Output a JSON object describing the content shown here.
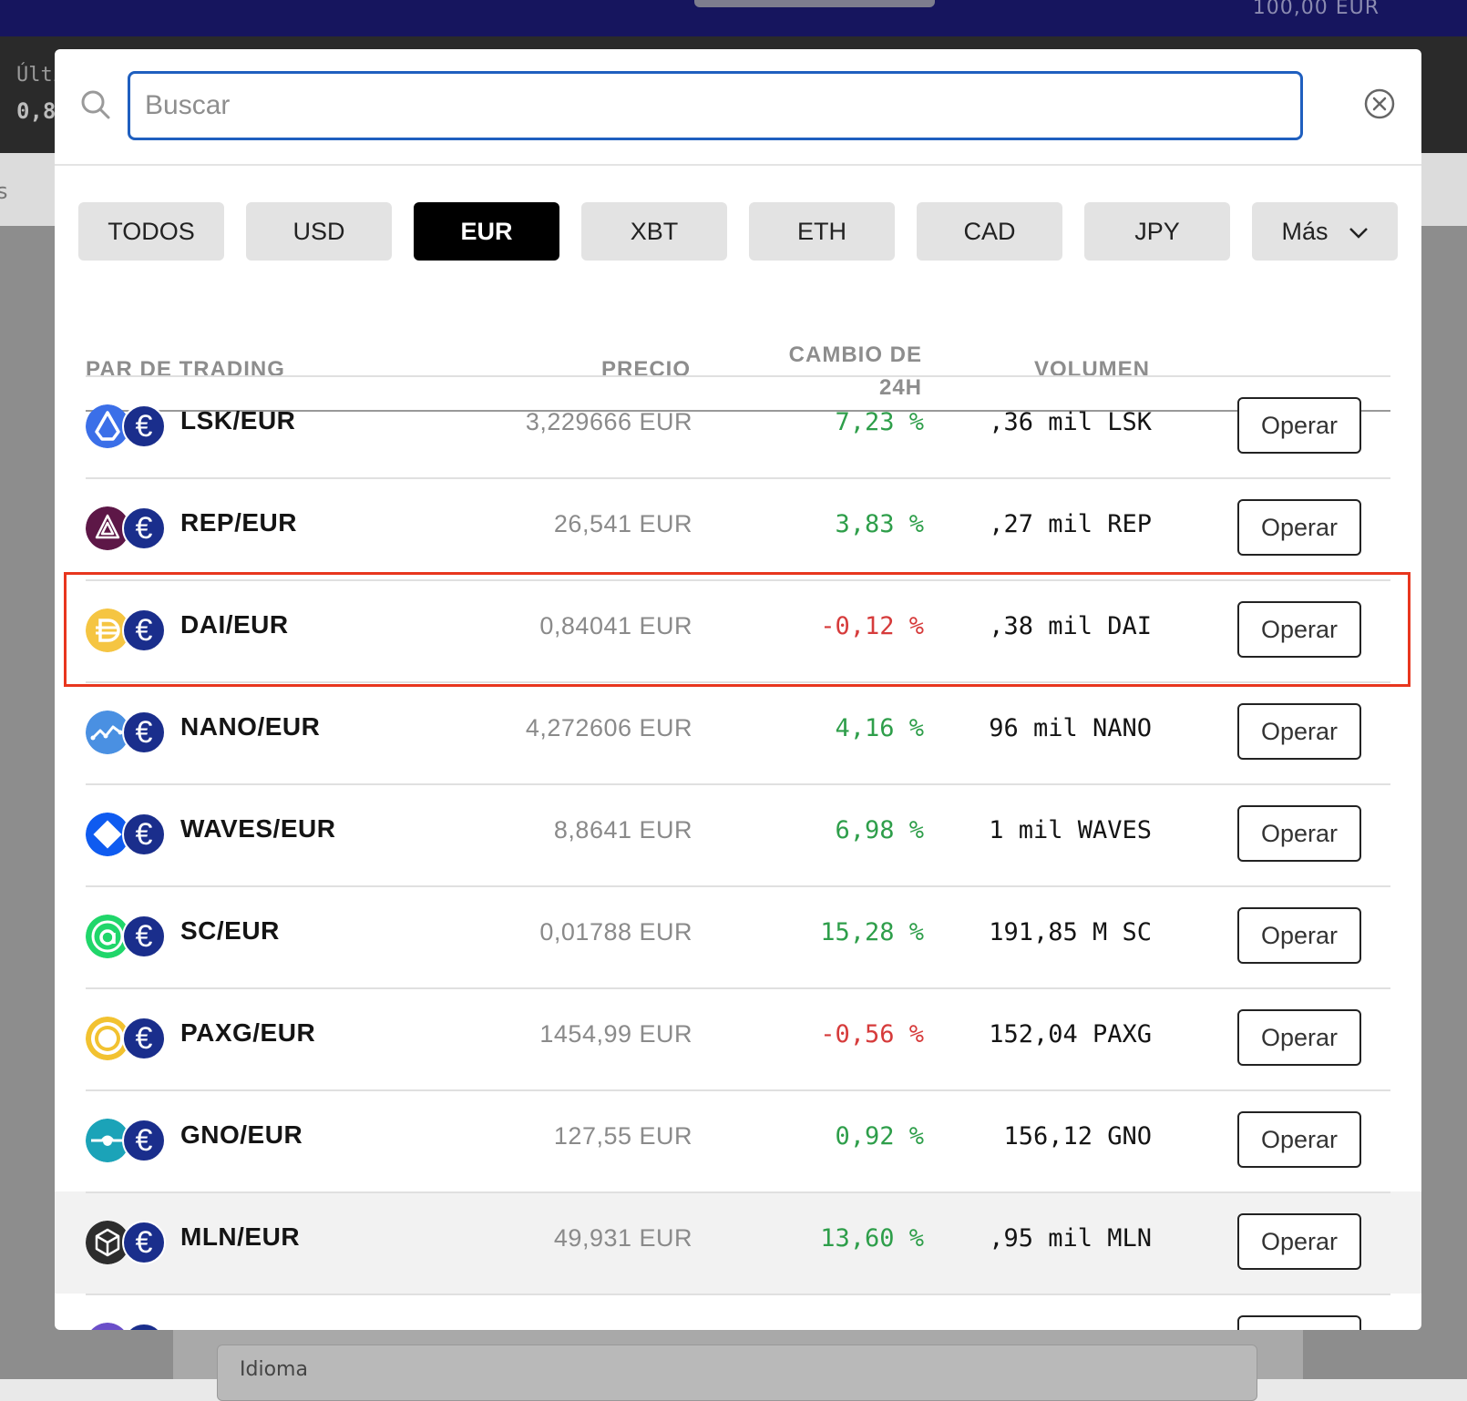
{
  "background": {
    "topbar_amount": "100,00 EUR",
    "last_label": "Últi",
    "last_value": "0,8",
    "side_label": "s",
    "language_label": "Idioma"
  },
  "search": {
    "placeholder": "Buscar",
    "value": ""
  },
  "tabs": [
    {
      "label": "TODOS",
      "active": false
    },
    {
      "label": "USD",
      "active": false
    },
    {
      "label": "EUR",
      "active": true
    },
    {
      "label": "XBT",
      "active": false
    },
    {
      "label": "ETH",
      "active": false
    },
    {
      "label": "CAD",
      "active": false
    },
    {
      "label": "JPY",
      "active": false
    },
    {
      "label": "Más",
      "active": false
    }
  ],
  "table": {
    "headers": {
      "pair": "PAR DE TRADING",
      "price": "PRECIO",
      "change_line1": "CAMBIO DE",
      "change_line2": "24H",
      "volume": "VOLUMEN"
    },
    "rows": [
      {
        "pair": "LSK/EUR",
        "price": "3,229666 EUR",
        "change": "7,23 %",
        "direction": "pos",
        "volume": ",36 mil LSK",
        "action": "Operar",
        "icon": "lisk-icon",
        "icon_color": "#3b6fe8"
      },
      {
        "pair": "REP/EUR",
        "price": "26,541 EUR",
        "change": "3,83 %",
        "direction": "pos",
        "volume": ",27 mil REP",
        "action": "Operar",
        "icon": "augur-icon",
        "icon_color": "#5d1747"
      },
      {
        "pair": "DAI/EUR",
        "price": "0,84041 EUR",
        "change": "-0,12 %",
        "direction": "neg",
        "volume": ",38 mil DAI",
        "action": "Operar",
        "icon": "dai-icon",
        "icon_color": "#f5c542"
      },
      {
        "pair": "NANO/EUR",
        "price": "4,272606 EUR",
        "change": "4,16 %",
        "direction": "pos",
        "volume": "96 mil NANO",
        "action": "Operar",
        "icon": "nano-icon",
        "icon_color": "#4a90e2"
      },
      {
        "pair": "WAVES/EUR",
        "price": "8,8641 EUR",
        "change": "6,98 %",
        "direction": "pos",
        "volume": "1 mil WAVES",
        "action": "Operar",
        "icon": "waves-icon",
        "icon_color": "#0f5bf0"
      },
      {
        "pair": "SC/EUR",
        "price": "0,01788 EUR",
        "change": "15,28 %",
        "direction": "pos",
        "volume": "191,85 M SC",
        "action": "Operar",
        "icon": "siacoin-icon",
        "icon_color": "#20d66a"
      },
      {
        "pair": "PAXG/EUR",
        "price": "1454,99 EUR",
        "change": "-0,56 %",
        "direction": "neg",
        "volume": "152,04 PAXG",
        "action": "Operar",
        "icon": "paxg-icon",
        "icon_color": "#f2c230"
      },
      {
        "pair": "GNO/EUR",
        "price": "127,55 EUR",
        "change": "0,92 %",
        "direction": "pos",
        "volume": "156,12 GNO",
        "action": "Operar",
        "icon": "gnosis-icon",
        "icon_color": "#1ba3b8"
      },
      {
        "pair": "MLN/EUR",
        "price": "49,931 EUR",
        "change": "13,60 %",
        "direction": "pos",
        "volume": ",95 mil MLN",
        "action": "Operar",
        "icon": "melon-icon",
        "icon_color": "#2d2d2d"
      }
    ]
  },
  "colors": {
    "accent": "#1f5fbf",
    "positive": "#2e9e4a",
    "negative": "#d63b3b",
    "euro_badge": "#1a2e8c",
    "highlight": "#e8361e"
  }
}
